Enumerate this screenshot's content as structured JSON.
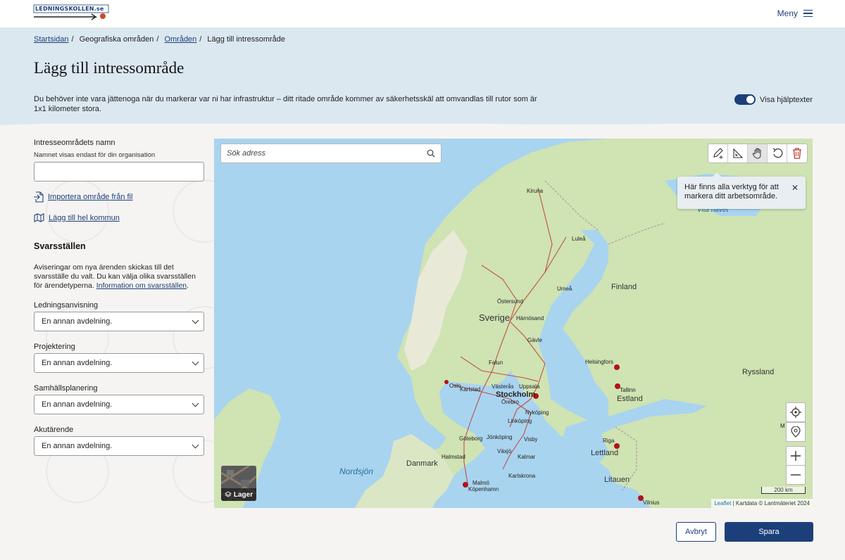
{
  "header": {
    "logo_text": "LEDNINGSKOLLEN.se",
    "menu_label": "Meny"
  },
  "breadcrumb": {
    "items": [
      "Startsidan",
      "Geografiska områden",
      "Områden",
      "Lägg till intressområde"
    ]
  },
  "page": {
    "title": "Lägg till intressområde",
    "description": "Du behöver inte vara jättenoga när du markerar var ni har infrastruktur – ditt ritade område kommer av säkerhetsskäl att omvandlas till rutor som är 1x1 kilometer stora.",
    "help_toggle_label": "Visa hjälptexter",
    "help_toggle_on": true
  },
  "form": {
    "name_label": "Intresseområdets namn",
    "name_hint": "Namnet visas endast för din organisation",
    "name_value": "",
    "import_link": "Importera område från fil",
    "municipality_link": "Lägg till hel kommun",
    "svar_heading": "Svarsställen",
    "svar_text": "Aviseringar om nya ärenden skickas till det svarsställe du valt. Du kan välja olika svarsställen för ärendetyperna.",
    "svar_link": "Information om svarsställen",
    "selects": [
      {
        "label": "Ledningsanvisning",
        "value": "En annan avdelning."
      },
      {
        "label": "Projektering",
        "value": "En annan avdelning."
      },
      {
        "label": "Samhällsplanering",
        "value": "En annan avdelning."
      },
      {
        "label": "Akutärende",
        "value": "En annan avdelning."
      }
    ]
  },
  "map": {
    "search_placeholder": "Sök adress",
    "tooltip": "Här finns alla verktyg för att markera ditt arbetsområde.",
    "layer_label": "Lager",
    "scale_label": "200 km",
    "attribution_leaflet": "Leaflet",
    "attribution_text": "| Kartdata © Lantmäteriet 2024",
    "tools": [
      "pencil-plus-icon",
      "ruler-triangle-icon",
      "hand-icon",
      "undo-icon",
      "trash-icon"
    ],
    "countries": [
      "Sverige",
      "Finland",
      "Ryssland",
      "Estland",
      "Lettland",
      "Litauen",
      "Danmark"
    ],
    "seas": [
      "Nordsjön",
      "Vita havet"
    ],
    "cities": [
      "Kiruna",
      "Luleå",
      "Umeå",
      "Östersund",
      "Härnösand",
      "Gävle",
      "Falun",
      "Oslo",
      "Karlstad",
      "Västerås",
      "Uppsala",
      "Stockholm",
      "Örebro",
      "Nyköping",
      "Linköping",
      "Göteborg",
      "Jönköping",
      "Växjö",
      "Visby",
      "Halmstad",
      "Kalmar",
      "Karlskrona",
      "Malmö",
      "Köpenhamn",
      "Helsingfors",
      "Tallinn",
      "Riga",
      "Vilnius",
      "M"
    ]
  },
  "actions": {
    "cancel_label": "Avbryt",
    "save_label": "Spara"
  },
  "colors": {
    "primary": "#1c3f7a",
    "hero_bg": "#dbe8f0",
    "page_bg": "#f5f4f2",
    "sea": "#a9d4ef",
    "land_green": "#cfe3b3",
    "route_red": "#c0392b"
  }
}
